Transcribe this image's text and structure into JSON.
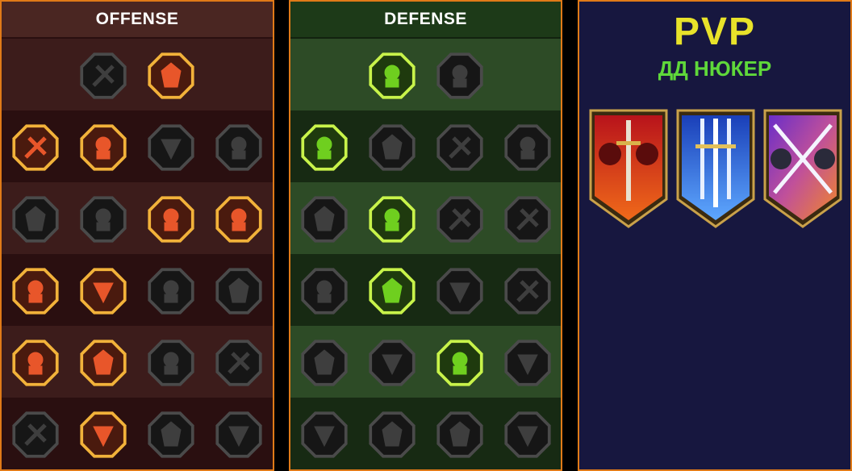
{
  "offense": {
    "title": "OFFENSE",
    "rows": [
      [
        "crossed-swords-icon",
        "triple-slash-icon"
      ],
      [
        "demon-horns-icon",
        "claw-slashes-icon",
        "shield-arrow-icon",
        "dark-heart-icon"
      ],
      [
        "flexing-warrior-icon",
        "fanged-maw-icon",
        "skull-wave-icon",
        "scythe-fist-icon"
      ],
      [
        "bleeding-heart-sword-icon",
        "hammer-fist-icon",
        "battle-axe-icon",
        "chain-lightning-icon"
      ],
      [
        "arrows-burst-icon",
        "triple-skull-icon",
        "dagger-ring-icon",
        "rage-warrior-icon"
      ],
      [
        "sparkle-sword-icon",
        "flaming-helm-icon",
        "horned-beast-icon",
        "skull-totem-icon"
      ]
    ],
    "active": [
      [
        false,
        true
      ],
      [
        true,
        true,
        false,
        false
      ],
      [
        false,
        false,
        true,
        true
      ],
      [
        true,
        true,
        false,
        false
      ],
      [
        true,
        true,
        false,
        false
      ],
      [
        false,
        true,
        false,
        false
      ]
    ]
  },
  "defense": {
    "title": "DEFENSE",
    "rows": [
      [
        "armor-plates-icon",
        "raised-fist-icon"
      ],
      [
        "chevron-shield-icon",
        "heart-hand-icon",
        "stone-golem-icon",
        "crossed-blades-icon"
      ],
      [
        "figure-shield-icon",
        "knight-shield-icon",
        "heart-shield-icon",
        "hooded-figure-icon"
      ],
      [
        "crowd-icon",
        "hourglass-icon",
        "open-palm-icon",
        "bull-head-icon"
      ],
      [
        "speed-runner-icon",
        "three-drops-icon",
        "radiant-skull-icon",
        "swirl-hand-icon"
      ],
      [
        "crowned-warrior-icon",
        "winged-shield-icon",
        "bearded-elder-icon",
        "strongman-icon"
      ]
    ],
    "active": [
      [
        true,
        false
      ],
      [
        true,
        false,
        false,
        false
      ],
      [
        false,
        true,
        false,
        false
      ],
      [
        false,
        true,
        false,
        false
      ],
      [
        false,
        false,
        true,
        false
      ],
      [
        false,
        false,
        false,
        false
      ]
    ]
  },
  "pvp": {
    "title": "PVP",
    "subtitle": "ДД НЮКЕР",
    "banners": [
      "red-knights-banner",
      "blue-swords-banner",
      "crossed-blades-banner"
    ]
  },
  "colors": {
    "offense_active": "#e8562a",
    "offense_border": "#f2b23a",
    "defense_active": "#6fcf1f",
    "defense_border": "#c8f34a",
    "inactive": "#3a3a3a"
  }
}
